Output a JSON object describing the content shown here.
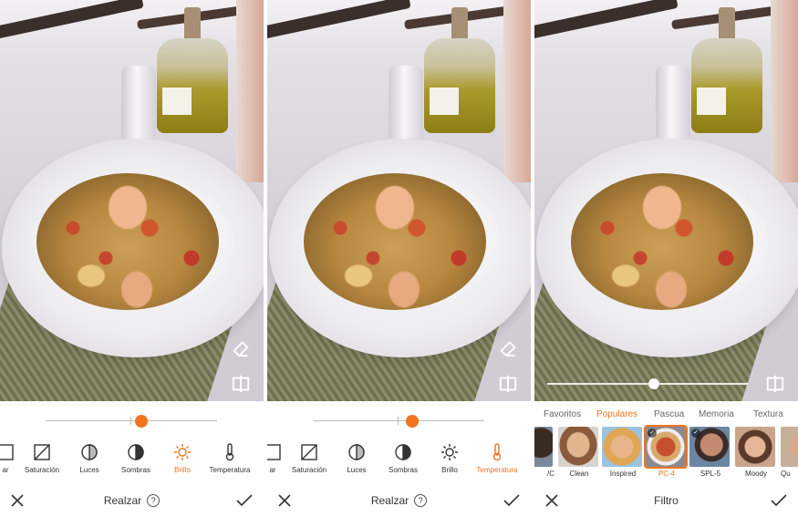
{
  "panels": [
    {
      "tools": [
        {
          "label": "ar",
          "icon": "partial-icon"
        },
        {
          "label": "Saturación",
          "icon": "saturation-icon"
        },
        {
          "label": "Luces",
          "icon": "highlights-icon"
        },
        {
          "label": "Sombras",
          "icon": "shadows-icon"
        },
        {
          "label": "Brillo",
          "icon": "brightness-icon",
          "active": true
        },
        {
          "label": "Temperatura",
          "icon": "temperature-icon"
        }
      ],
      "slider_value": 0.55,
      "bottom_title": "Realzar",
      "help": "?"
    },
    {
      "tools": [
        {
          "label": "ar",
          "icon": "partial-icon"
        },
        {
          "label": "Saturación",
          "icon": "saturation-icon"
        },
        {
          "label": "Luces",
          "icon": "highlights-icon"
        },
        {
          "label": "Sombras",
          "icon": "shadows-icon"
        },
        {
          "label": "Brillo",
          "icon": "brightness-icon"
        },
        {
          "label": "Temperatura",
          "icon": "temperature-icon",
          "active": true
        }
      ],
      "slider_value": 0.58,
      "bottom_title": "Realzar",
      "help": "?"
    },
    {
      "categories": [
        "Favoritos",
        "Populares",
        "Pascua",
        "Memoria",
        "Textura"
      ],
      "active_category": "Populares",
      "filters": [
        {
          "name": "/C",
          "checked": false
        },
        {
          "name": "Clean",
          "checked": false
        },
        {
          "name": "Inspired",
          "checked": false
        },
        {
          "name": "PC-4",
          "checked": true,
          "active": true
        },
        {
          "name": "SPL-5",
          "checked": true
        },
        {
          "name": "Moody",
          "checked": false
        },
        {
          "name": "Qu",
          "checked": false
        }
      ],
      "filter_strength": 0.5,
      "bottom_title": "Filtro"
    }
  ],
  "colors": {
    "accent": "#f27320"
  }
}
